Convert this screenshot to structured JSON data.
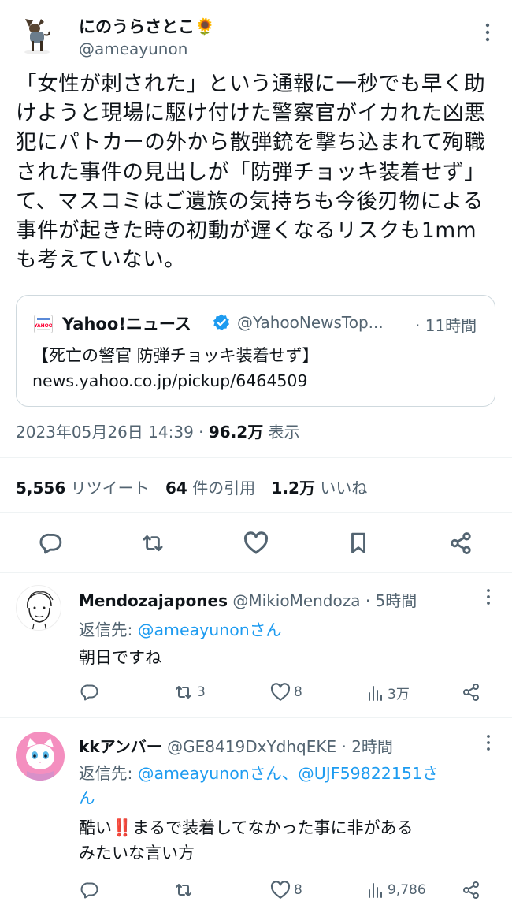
{
  "main_tweet": {
    "display_name": "にのうらさとこ🌻",
    "handle": "@ameayunon",
    "text": "「女性が刺された」という通報に一秒でも早く助けようと現場に駆け付けた警察官がイカれた凶悪犯にパトカーの外から散弾銃を撃ち込まれて殉職された事件の見出しが「防弾チョッキ装着せず」て、マスコミはご遺族の気持ちも今後刃物による事件が起きた時の初動が遅くなるリスクも1mmも考えていない。",
    "quote": {
      "account_name": "Yahoo!ニュース",
      "handle": "@YahooNewsTop...",
      "time": "· 11時間",
      "headline": "【死亡の警官 防弾チョッキ装着せず】",
      "link": "news.yahoo.co.jp/pickup/6464509"
    },
    "timestamp": "2023年05月26日 14:39",
    "views_sep": "·",
    "views_count": "96.2万",
    "views_label": "表示",
    "stats": {
      "retweets_count": "5,556",
      "retweets_label": "リツイート",
      "quotes_count": "64",
      "quotes_label": "件の引用",
      "likes_count": "1.2万",
      "likes_label": "いいね"
    }
  },
  "replies": [
    {
      "display_name": "Mendozajapones",
      "handle": "@MikioMendoza",
      "time": "· 5時間",
      "reply_to_prefix": "返信先: ",
      "reply_to_links": "@ameayunonさん",
      "text": "朝日ですね",
      "retweets": "3",
      "likes": "8",
      "views": "3万"
    },
    {
      "display_name": "kkアンバー",
      "handle": "@GE8419DxYdhqEKE",
      "time": "· 2時間",
      "reply_to_prefix": "返信先: ",
      "reply_to_links_line1": "@ameayunonさん、@UJF59822151さ",
      "reply_to_links_line2": "ん",
      "text_line1": "酷い‼️まるで装着してなかった事に非がある",
      "text_line2": "みたいな言い方",
      "retweets": "",
      "likes": "8",
      "views": "9,786"
    }
  ],
  "colors": {
    "link": "#1d9bf0",
    "muted": "#536471",
    "text": "#0f1419",
    "verified": "#1d9bf0"
  },
  "icons": [
    "more-icon",
    "reply-icon",
    "retweet-icon",
    "like-icon",
    "bookmark-icon",
    "share-icon",
    "views-icon",
    "verified-badge-icon",
    "yahoo-logo-icon"
  ]
}
